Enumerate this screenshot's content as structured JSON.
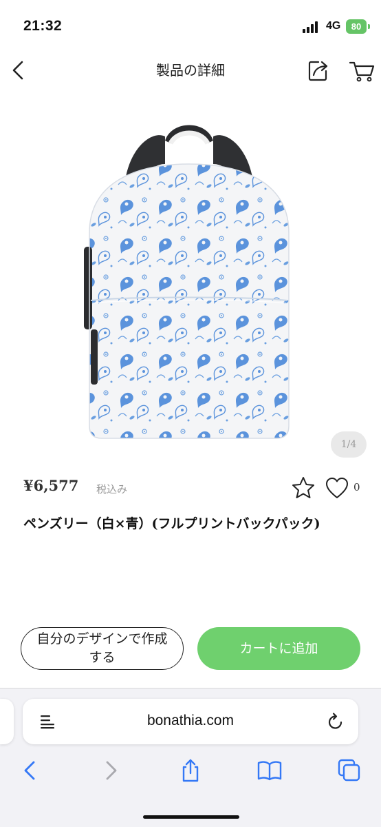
{
  "status_bar": {
    "time": "21:32",
    "network": "4G",
    "battery": "80"
  },
  "nav": {
    "title": "製品の詳細"
  },
  "product": {
    "image_pager": "1/4",
    "price": "¥6,577",
    "tax_note": "税込み",
    "like_count": "0",
    "title": "ペンズリー（白×青）(フルプリントバックパック)"
  },
  "actions": {
    "design_label": "自分のデザインで作成する",
    "add_to_cart_label": "カートに追加"
  },
  "browser": {
    "url": "bonathia.com"
  },
  "icons": {
    "back": "chevron-left-icon",
    "share": "share-icon",
    "cart": "cart-icon",
    "favorite": "star-icon",
    "like": "heart-icon",
    "reader": "reader-mode-icon",
    "reload": "reload-icon",
    "browser_back": "chevron-left-icon",
    "browser_forward": "chevron-right-icon",
    "browser_share": "share-icon",
    "bookmarks": "book-icon",
    "tabs": "tabs-icon"
  },
  "colors": {
    "accent_green": "#6fd06e",
    "battery_green": "#65c466",
    "safari_blue": "#3478f6",
    "pattern_blue": "#4a86d8",
    "backpack_strap": "#333538"
  }
}
